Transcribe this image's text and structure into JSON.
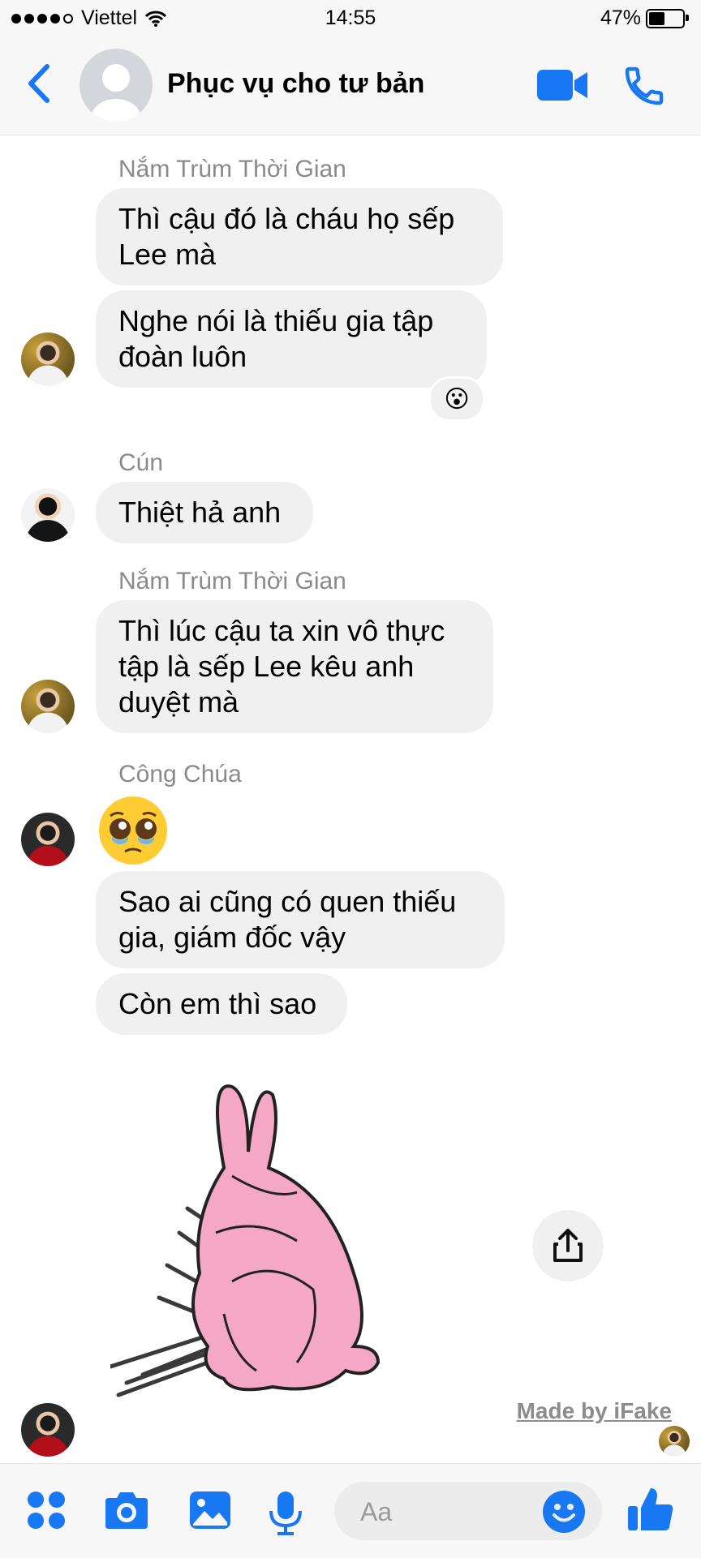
{
  "status_bar": {
    "carrier": "Viettel",
    "time": "14:55",
    "battery": "47%",
    "battery_level": 0.47
  },
  "header": {
    "title": "Phục vụ cho tư bản",
    "back_icon": "chevron-left-icon",
    "video_icon": "video-camera-icon",
    "call_icon": "phone-icon"
  },
  "messages": {
    "group1": {
      "sender": "Nắm Trùm Thời Gian",
      "m1": "Thì cậu đó là cháu họ sếp Lee mà",
      "m2": "Nghe nói là thiếu gia tập đoàn luôn",
      "reaction": "😮"
    },
    "group2": {
      "sender": "Cún",
      "m1": "Thiệt hả anh"
    },
    "group3": {
      "sender": "Nắm Trùm Thời Gian",
      "m1": "Thì lúc cậu ta xin vô thực tập là sếp Lee kêu anh duyệt mà"
    },
    "group4": {
      "sender": "Công Chúa",
      "emoji": "🥺",
      "m1": "Sao ai cũng có quen thiếu gia, giám đốc vậy",
      "m2": "Còn em thì sao",
      "sticker": "pink-rabbit-sticker"
    }
  },
  "watermark": "Made by iFake",
  "composer": {
    "placeholder": "Aa"
  },
  "colors": {
    "accent": "#1877f2",
    "bubble": "#f0f0f0",
    "sender": "#8a8a8a",
    "bar": "#f7f7f7"
  }
}
